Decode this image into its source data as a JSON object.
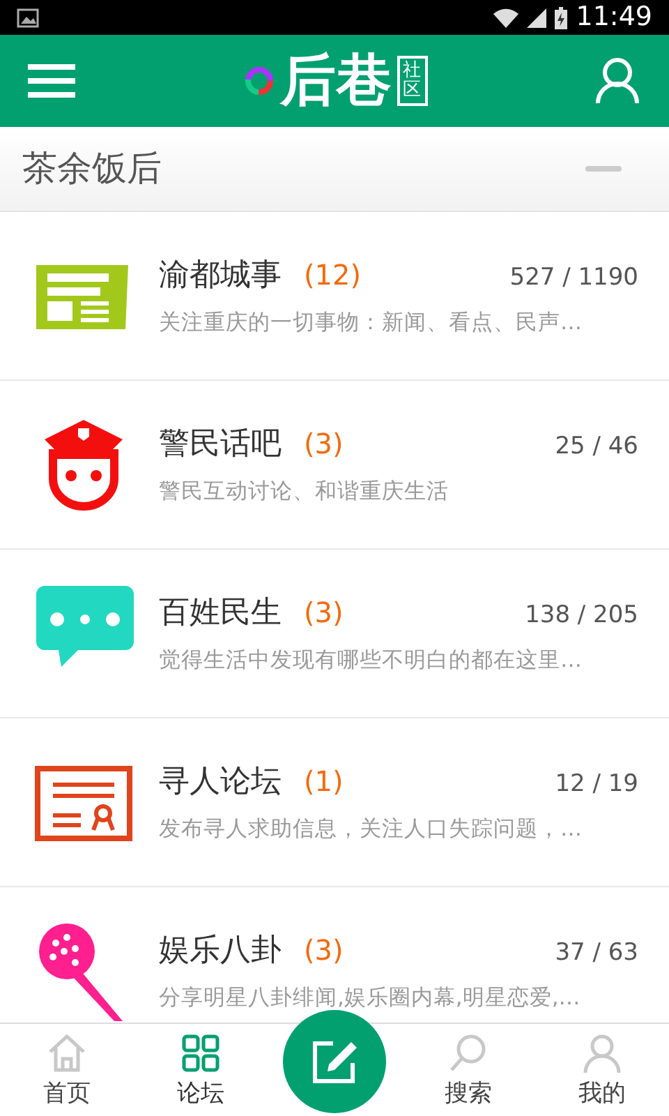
{
  "status_bar": {
    "time": "11:49"
  },
  "header": {
    "logo": {
      "text": "后巷",
      "stamp": "社区"
    }
  },
  "section": {
    "title": "茶余饭后",
    "expanded": true
  },
  "forums": [
    {
      "kind": "newspaper",
      "color": "#a3c81c",
      "title": "渝都城事",
      "count": "(12)",
      "stats": "527 / 1190",
      "description": "关注重庆的一切事物：新闻、看点、民声…"
    },
    {
      "kind": "police",
      "color": "#f40f0f",
      "title": "警民话吧",
      "count": "(3)",
      "stats": "25 / 46",
      "description": "警民互动讨论、和谐重庆生活"
    },
    {
      "kind": "chat",
      "color": "#22d8c0",
      "title": "百姓民生",
      "count": "(3)",
      "stats": "138 / 205",
      "description": "觉得生活中发现有哪些不明白的都在这里…"
    },
    {
      "kind": "certificate",
      "color": "#e0441c",
      "title": "寻人论坛",
      "count": "(1)",
      "stats": "12 / 19",
      "description": "发布寻人求助信息，关注人口失踪问题，…"
    },
    {
      "kind": "microphone",
      "color": "#ff1f8e",
      "title": "娱乐八卦",
      "count": "(3)",
      "stats": "37 / 63",
      "description": "分享明星八卦绯闻,娱乐圈内幕,明星恋爱,…"
    }
  ],
  "bottom_nav": [
    {
      "kind": "home",
      "label": "首页",
      "selected": false
    },
    {
      "kind": "grid",
      "label": "论坛",
      "selected": true
    },
    {
      "kind": "search",
      "label": "搜索",
      "selected": false
    },
    {
      "kind": "user",
      "label": "我的",
      "selected": false
    }
  ]
}
